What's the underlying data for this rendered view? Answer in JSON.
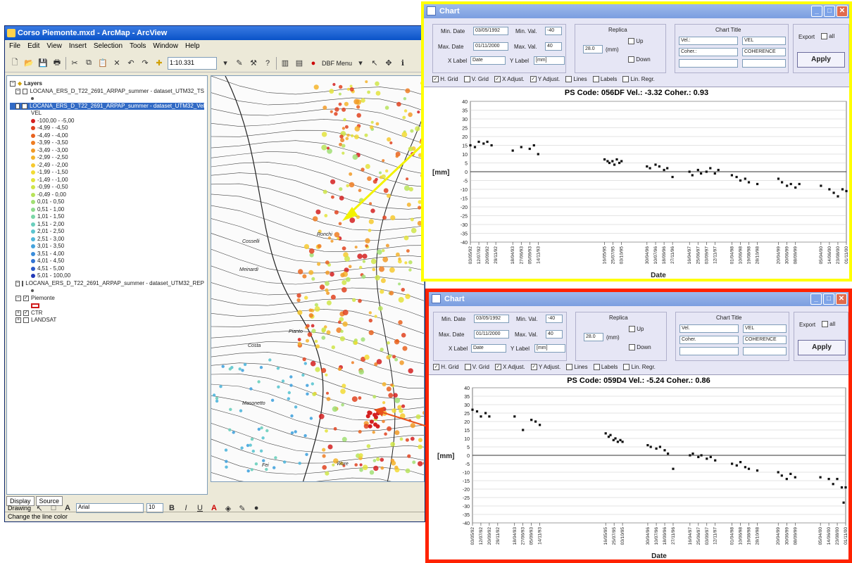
{
  "arcmap": {
    "title": "Corso Piemonte.mxd - ArcMap - ArcView",
    "menu": [
      "File",
      "Edit",
      "View",
      "Insert",
      "Selection",
      "Tools",
      "Window",
      "Help"
    ],
    "scale": "1:10.331",
    "dbf_menu": "DBF Menu",
    "toc": {
      "layers_label": "Layers",
      "layer_ts": "LOCANA_ERS_D_T22_2691_ARPAP_summer - dataset_UTM32_TS",
      "layer_vel": "LOCANA_ERS_D_T22_2691_ARPAP_summer - dataset_UTM32_Vel",
      "field": "VEL",
      "classes": [
        {
          "label": "-100,00 - -5,00",
          "color": "#d41f1f"
        },
        {
          "label": "-4,99 - -4,50",
          "color": "#e0421e"
        },
        {
          "label": "-4,49 - -4,00",
          "color": "#e8621f"
        },
        {
          "label": "-3,99 - -3,50",
          "color": "#ee7d22"
        },
        {
          "label": "-3,49 - -3,00",
          "color": "#f19a26"
        },
        {
          "label": "-2,99 - -2,50",
          "color": "#f4b42a"
        },
        {
          "label": "-2,49 - -2,00",
          "color": "#f6c92e"
        },
        {
          "label": "-1,99 - -1,50",
          "color": "#f2db33"
        },
        {
          "label": "-1,49 - -1,00",
          "color": "#e3e33c"
        },
        {
          "label": "-0,99 - -0,50",
          "color": "#cfe548"
        },
        {
          "label": "-0,49 - 0,00",
          "color": "#b7e35a"
        },
        {
          "label": "0,01 - 0,50",
          "color": "#a1df74"
        },
        {
          "label": "0,51 - 1,00",
          "color": "#8ddb8e"
        },
        {
          "label": "1,01 - 1,50",
          "color": "#7ad6a6"
        },
        {
          "label": "1,51 - 2,00",
          "color": "#6acfbd"
        },
        {
          "label": "2,01 - 2,50",
          "color": "#5cc5d0"
        },
        {
          "label": "2,51 - 3,00",
          "color": "#50b6db"
        },
        {
          "label": "3,01 - 3,50",
          "color": "#44a3de"
        },
        {
          "label": "3,51 - 4,00",
          "color": "#3b8ddb"
        },
        {
          "label": "4,01 - 4,50",
          "color": "#3274d4"
        },
        {
          "label": "4,51 - 5,00",
          "color": "#2a59c9"
        },
        {
          "label": "5,01 - 100,00",
          "color": "#2238b8"
        }
      ],
      "layer_rep": "LOCANA_ERS_D_T22_2691_ARPAP_summer - dataset_UTM32_REP",
      "layer_piemonte": "Piemonte",
      "layer_ctr": "CTR",
      "layer_landsat": "LANDSAT",
      "tab_display": "Display",
      "tab_source": "Source"
    },
    "map_labels": [
      "Ronchi",
      "Cosselli",
      "Meinardi",
      "Pianto",
      "Costa",
      "Masonetto",
      "Fei",
      "Wore"
    ],
    "drawing_label": "Drawing",
    "font_name": "Arial",
    "font_size": "10",
    "status": "Change the line color"
  },
  "chart1": {
    "window_title": "Chart",
    "min_date_label": "Min. Date",
    "min_date": "03/05/1992",
    "max_date_label": "Max. Date",
    "max_date": "01/11/2000",
    "min_val_label": "Min. Val.",
    "min_val": "-40",
    "max_val_label": "Max. Val.",
    "max_val": "40",
    "replica_label": "Replica",
    "replica_value": "28.0",
    "replica_unit": "(mm)",
    "up_label": "Up",
    "down_label": "Down",
    "xlabel_label": "X Label",
    "xlabel_value": "Date",
    "ylabel_label": "Y Label",
    "ylabel_value": "[mm]",
    "chart_title_label": "Chart Title",
    "title_f1": "Vel.:",
    "title_f2": "Coher.:",
    "sel1": "VEL",
    "sel2": "COHERENCE",
    "export_label": "Export",
    "all_label": "all",
    "apply_label": "Apply",
    "opts": [
      "H. Grid",
      "V. Grid",
      "X Adjust.",
      "Y Adjust.",
      "Lines",
      "Labels",
      "Lin. Regr."
    ],
    "checked": [
      true,
      false,
      true,
      true,
      false,
      false,
      false
    ]
  },
  "chart2": {
    "window_title": "Chart",
    "min_date_label": "Min. Date",
    "min_date": "03/05/1992",
    "max_date_label": "Max. Date",
    "max_date": "01/11/2000",
    "min_val_label": "Min. Val.",
    "min_val": "-40",
    "max_val_label": "Max. Val.",
    "max_val": "40",
    "replica_label": "Replica",
    "replica_value": "28.0",
    "replica_unit": "(mm)",
    "up_label": "Up",
    "down_label": "Down",
    "xlabel_label": "X Label",
    "xlabel_value": "Date",
    "ylabel_label": "Y Label",
    "ylabel_value": "[mm]",
    "chart_title_label": "Chart Title",
    "title_f1": "Vel.",
    "title_f2": "Coher.",
    "sel1": "VEL",
    "sel2": "COHERENCE",
    "export_label": "Export",
    "all_label": "all",
    "apply_label": "Apply",
    "opts": [
      "H. Grid",
      "V. Grid",
      "X Adjust.",
      "Y Adjust.",
      "Lines",
      "Labels",
      "Lin. Regr."
    ],
    "checked": [
      true,
      false,
      true,
      true,
      false,
      false,
      false
    ]
  },
  "chart_data": [
    {
      "type": "scatter",
      "title": "PS Code: 056DF   Vel.: -3.32   Coher.: 0.93",
      "xlabel": "Date",
      "ylabel": "[mm]",
      "ylim": [
        -40,
        40
      ],
      "xlim": [
        "1992-05-03",
        "2000-11-01"
      ],
      "grid": "horizontal",
      "x_tick_labels": [
        "03/05/92",
        "12/07/92",
        "20/09/92",
        "29/11/92",
        "18/04/93",
        "27/06/93",
        "05/09/93",
        "14/11/93",
        "16/05/95",
        "25/07/95",
        "03/10/95",
        "30/04/96",
        "10/07/96",
        "18/09/96",
        "27/11/96",
        "16/04/97",
        "25/06/97",
        "03/09/97",
        "12/11/97",
        "01/04/98",
        "10/06/98",
        "19/08/98",
        "28/10/98",
        "20/04/99",
        "30/06/99",
        "08/09/99",
        "05/04/00",
        "14/06/00",
        "23/08/00",
        "01/11/00"
      ],
      "x": [
        "1992-05-03",
        "1992-06-10",
        "1992-07-12",
        "1992-08-20",
        "1992-09-20",
        "1992-10-25",
        "1993-04-18",
        "1993-06-27",
        "1993-09-05",
        "1993-10-10",
        "1993-11-14",
        "1995-05-16",
        "1995-06-10",
        "1995-06-25",
        "1995-07-20",
        "1995-08-05",
        "1995-08-25",
        "1995-09-15",
        "1995-10-03",
        "1996-04-30",
        "1996-05-25",
        "1996-07-10",
        "1996-08-10",
        "1996-09-18",
        "1996-10-15",
        "1996-11-27",
        "1997-04-16",
        "1997-05-10",
        "1997-06-25",
        "1997-07-20",
        "1997-09-03",
        "1997-10-05",
        "1997-11-12",
        "1997-12-10",
        "1998-04-01",
        "1998-05-10",
        "1998-06-10",
        "1998-07-20",
        "1998-08-19",
        "1998-10-28",
        "1999-04-20",
        "1999-05-20",
        "1999-06-30",
        "1999-08-01",
        "1999-09-08",
        "1999-10-10",
        "2000-04-05",
        "2000-06-14",
        "2000-07-20",
        "2000-08-23",
        "2000-09-30",
        "2000-11-01"
      ],
      "y": [
        15,
        14,
        17,
        16,
        17,
        15,
        12,
        14,
        13,
        15,
        10,
        7,
        6,
        5,
        6,
        4,
        7,
        5,
        6,
        3,
        2,
        4,
        3,
        1,
        2,
        -3,
        0,
        -2,
        1,
        -1,
        0,
        2,
        -1,
        1,
        -2,
        -3,
        -5,
        -4,
        -6,
        -7,
        -4,
        -6,
        -8,
        -7,
        -9,
        -7,
        -8,
        -10,
        -12,
        -14,
        -10,
        -11
      ]
    },
    {
      "type": "scatter",
      "title": "PS Code: 059D4   Vel.: -5.24   Coher.: 0.86",
      "xlabel": "Date",
      "ylabel": "[mm]",
      "ylim": [
        -40,
        40
      ],
      "xlim": [
        "1992-05-03",
        "2000-11-01"
      ],
      "grid": "horizontal",
      "x_tick_labels": [
        "03/05/92",
        "12/07/92",
        "20/09/92",
        "29/11/92",
        "18/04/93",
        "27/06/93",
        "05/09/93",
        "14/11/93",
        "16/05/95",
        "25/07/95",
        "03/10/95",
        "30/04/96",
        "10/07/96",
        "18/09/96",
        "27/11/96",
        "16/04/97",
        "25/06/97",
        "03/09/97",
        "12/11/97",
        "01/04/98",
        "10/06/98",
        "19/08/98",
        "28/10/98",
        "20/04/99",
        "30/06/99",
        "08/09/99",
        "05/04/00",
        "14/06/00",
        "23/08/00",
        "01/11/00"
      ],
      "x": [
        "1992-05-03",
        "1992-06-10",
        "1992-07-12",
        "1992-08-20",
        "1992-09-20",
        "1993-04-18",
        "1993-06-27",
        "1993-09-05",
        "1993-10-10",
        "1993-11-14",
        "1995-05-16",
        "1995-06-10",
        "1995-06-25",
        "1995-07-20",
        "1995-08-05",
        "1995-08-25",
        "1995-09-15",
        "1995-10-03",
        "1996-04-30",
        "1996-05-25",
        "1996-07-10",
        "1996-08-10",
        "1996-09-18",
        "1996-10-15",
        "1996-11-27",
        "1997-04-16",
        "1997-05-10",
        "1997-06-25",
        "1997-07-20",
        "1997-09-03",
        "1997-10-05",
        "1997-11-12",
        "1998-04-01",
        "1998-05-10",
        "1998-06-10",
        "1998-07-20",
        "1998-08-19",
        "1998-10-28",
        "1999-04-20",
        "1999-05-20",
        "1999-06-30",
        "1999-08-01",
        "1999-09-08",
        "2000-04-05",
        "2000-06-14",
        "2000-07-20",
        "2000-08-23",
        "2000-09-30",
        "2000-10-15",
        "2000-11-01"
      ],
      "y": [
        27,
        26,
        23,
        25,
        23,
        23,
        15,
        21,
        20,
        18,
        13,
        11,
        12,
        9,
        10,
        8,
        9,
        8,
        6,
        5,
        4,
        5,
        3,
        1,
        -8,
        0,
        1,
        -1,
        0,
        -2,
        -1,
        -3,
        -5,
        -6,
        -4,
        -7,
        -8,
        -9,
        -10,
        -12,
        -14,
        -11,
        -13,
        -13,
        -14,
        -17,
        -14,
        -19,
        -28,
        -19
      ]
    }
  ]
}
